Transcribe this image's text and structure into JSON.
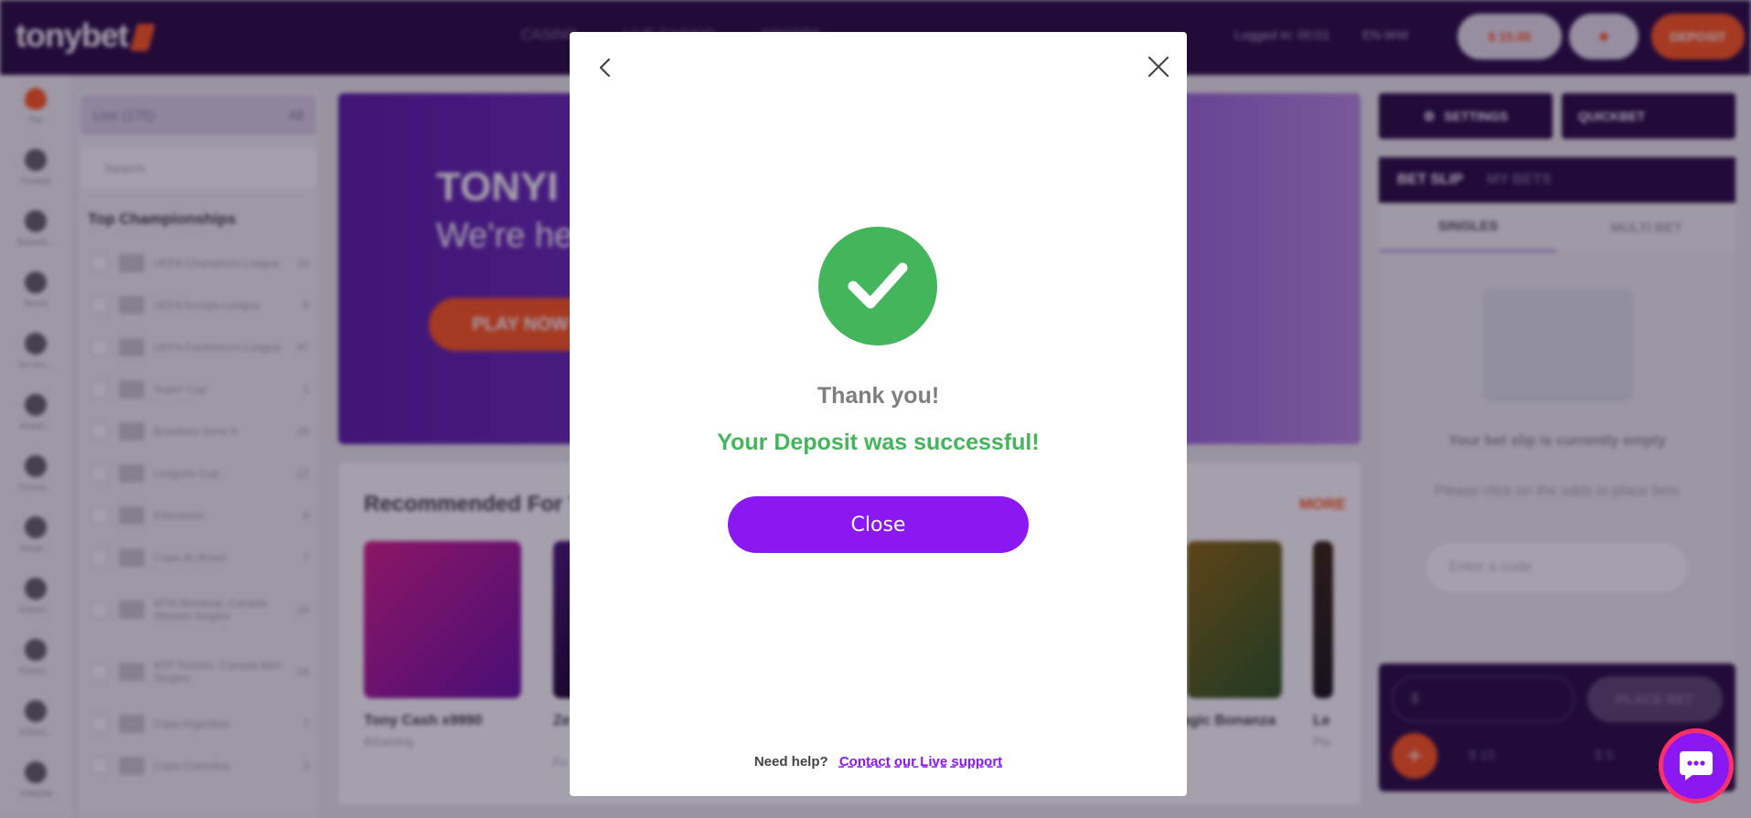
{
  "header": {
    "logo_text": "tonybet",
    "nav": [
      "CASINO",
      "LIVE CASINO",
      "SPORTS"
    ],
    "logged_in": "Logged in: 00:01",
    "language": "EN-WW",
    "balance": "$ 15.00",
    "deposit_label": "DEPOSIT"
  },
  "left_rail": {
    "items": [
      "Top",
      "Football",
      "Basketb...",
      "Tennis",
      "Ice Hoc...",
      "Americ...",
      "Formul...",
      "Virtual ...",
      "ESport...",
      "ESport...",
      "ESport...",
      "Volleybal"
    ]
  },
  "championships": {
    "live_label": "Live (175)",
    "filter_label": "All",
    "search_placeholder": "Search",
    "title": "Top Championships",
    "rows": [
      {
        "name": "UEFA Champions League",
        "count": "10"
      },
      {
        "name": "UEFA Europa League",
        "count": "6"
      },
      {
        "name": "UEFA Conference League",
        "count": "47"
      },
      {
        "name": "Super Cup",
        "count": "1"
      },
      {
        "name": "Brasileiro Serie A",
        "count": "20"
      },
      {
        "name": "Leagues Cup",
        "count": "12"
      },
      {
        "name": "Eliteserien",
        "count": "8"
      },
      {
        "name": "Copa do Brasil",
        "count": "7"
      },
      {
        "name": "WTA Montreal, Canada Women Singles",
        "count": "24"
      },
      {
        "name": "ATP Toronto, Canada Men Singles",
        "count": "24"
      },
      {
        "name": "Copa Argentina",
        "count": "7"
      },
      {
        "name": "Copa Colombia",
        "count": "3"
      }
    ]
  },
  "banner": {
    "title": "TONYI",
    "subtitle": "We're he",
    "play_label": "PLAY NOW"
  },
  "recommended": {
    "title": "Recommended For Y",
    "more_label": "MORE",
    "games": [
      {
        "name": "Tony Cash x9990",
        "provider": "BGaming"
      },
      {
        "name": "Ze Ru",
        "provider": "Fo"
      },
      {
        "name": "agic Bonanza",
        "provider": ""
      },
      {
        "name": "Le",
        "provider": "Pla"
      }
    ]
  },
  "betslip": {
    "settings_label": "SETTINGS",
    "quickbet_label": "QUICKBET",
    "tab_betslip": "BET SLIP",
    "tab_mybets": "MY BETS",
    "tab_singles": "SINGLES",
    "tab_multi": "MULTI BET",
    "empty_title": "Your bet slip is currently empty",
    "empty_hint": "Please click on the odds to place bets",
    "code_placeholder": "Enter a code",
    "stake_placeholder": "$",
    "place_bet_label": "PLACE BET",
    "preset_1": "$ 15",
    "preset_2": "$ 5"
  },
  "modal": {
    "thank_you": "Thank you!",
    "message": "Your Deposit was successful!",
    "close_label": "Close",
    "help_label": "Need help?",
    "help_link": "Contact our Live support",
    "accent_color": "#8b17f2",
    "success_color": "#43b55a"
  }
}
